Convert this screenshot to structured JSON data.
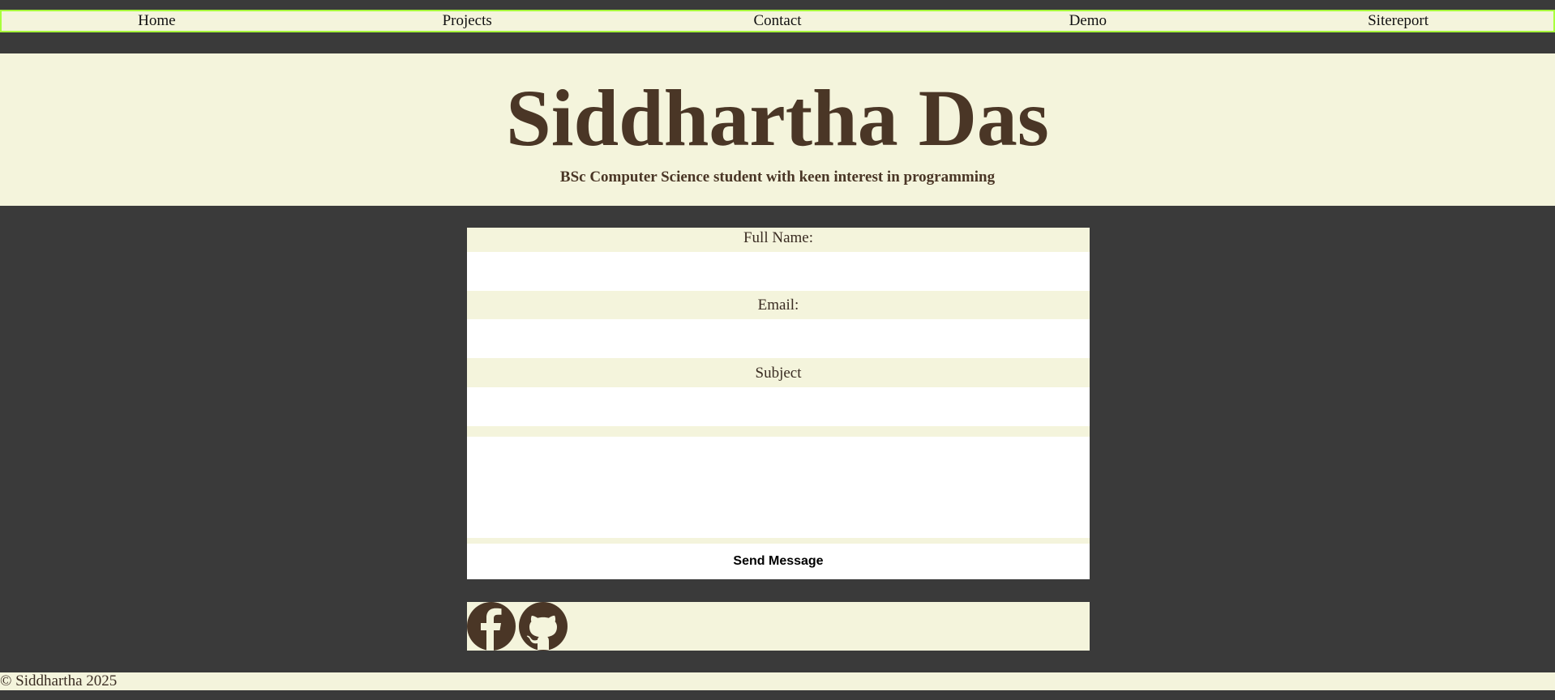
{
  "nav": {
    "items": [
      {
        "label": "Home"
      },
      {
        "label": "Projects"
      },
      {
        "label": "Contact"
      },
      {
        "label": "Demo"
      },
      {
        "label": "Sitereport"
      }
    ]
  },
  "header": {
    "title": "Siddhartha Das",
    "subtitle": "BSc Computer Science student with keen interest in programming"
  },
  "form": {
    "full_name_label": "Full Name:",
    "full_name_value": "",
    "email_label": "Email:",
    "email_value": "",
    "subject_label": "Subject",
    "subject_value": "",
    "message_value": "",
    "submit_label": "Send Message"
  },
  "social": {
    "icons": [
      "facebook-icon",
      "github-icon"
    ]
  },
  "footer": {
    "copyright": "© Siddhartha 2025"
  },
  "colors": {
    "background": "#3a3a3a",
    "panel": "#f4f4dc",
    "brand_brown": "#4a3626",
    "nav_border": "#a8ff3c"
  }
}
